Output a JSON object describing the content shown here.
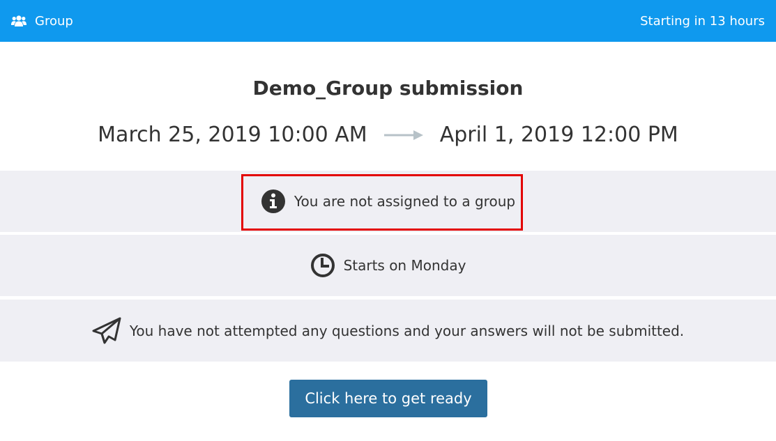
{
  "header": {
    "icon": "users-icon",
    "title": "Group",
    "status": "Starting in 13 hours",
    "background_color": "#0f99ee"
  },
  "main": {
    "title": "Demo_Group submission",
    "start_date": "March 25, 2019 10:00 AM",
    "end_date": "April 1, 2019 12:00 PM",
    "arrow_icon": "arrow-right-icon"
  },
  "notices": [
    {
      "icon": "info-circle-icon",
      "text": "You are not assigned to a group",
      "highlighted": true
    },
    {
      "icon": "clock-icon",
      "text": "Starts on Monday"
    },
    {
      "icon": "paper-plane-icon",
      "text": "You have not attempted any questions and your answers will not be submitted."
    }
  ],
  "actions": {
    "ready_label": "Click here to get ready",
    "button_color": "#2b6f9e"
  },
  "colors": {
    "highlight_border": "#e30000",
    "panel_background": "#efeff4"
  }
}
